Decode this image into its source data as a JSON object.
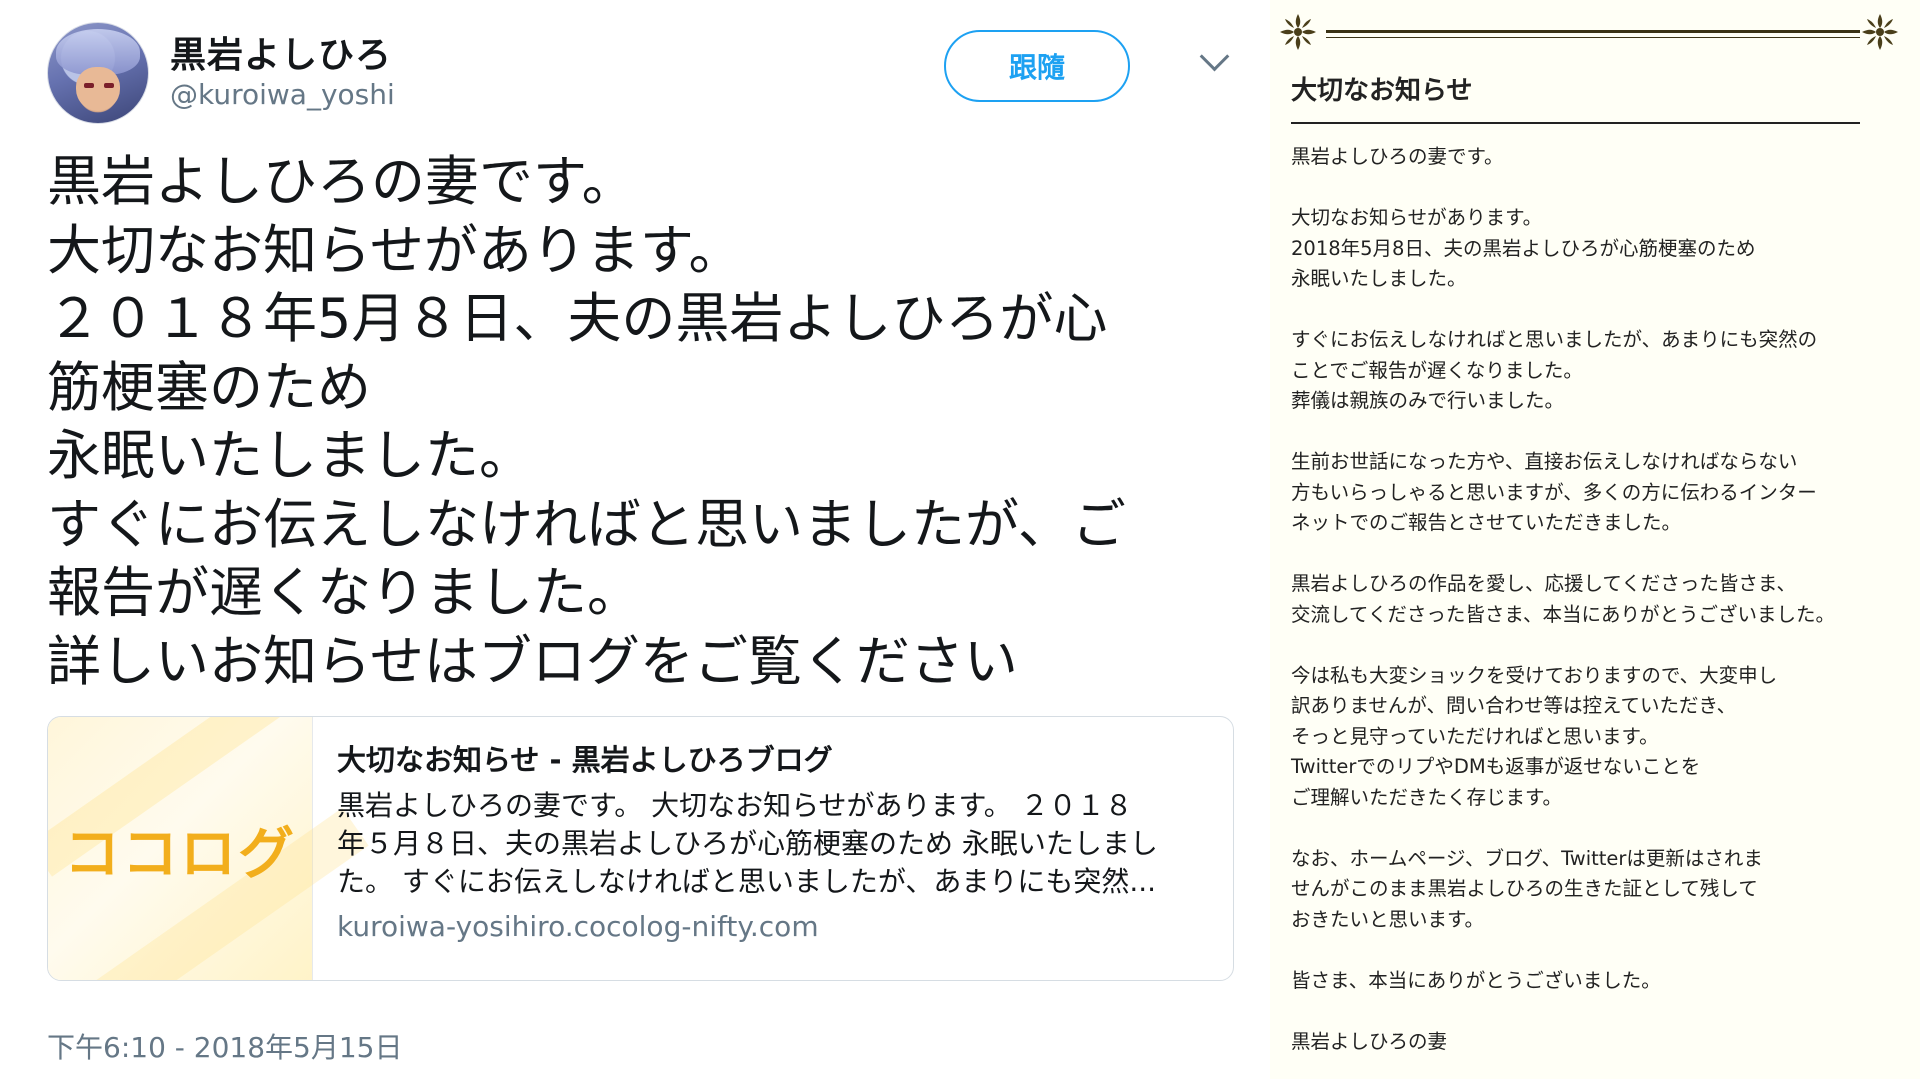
{
  "tweet": {
    "display_name": "黒岩よしひろ",
    "handle": "@kuroiwa_yoshi",
    "follow_label": "跟隨",
    "text_lines": [
      "黒岩よしひろの妻です。",
      "大切なお知らせがあります。",
      "２０１８年5月８日、夫の黒岩よしひろが心",
      "筋梗塞のため",
      "永眠いたしました。",
      "すぐにお伝えしなければと思いましたが、ご",
      "報告が遅くなりました。",
      "詳しいお知らせはブログをご覧ください"
    ],
    "card": {
      "logo_text": "ココログ",
      "title": "大切なお知らせ - 黒岩よしひろブログ",
      "desc_lines": [
        "黒岩よしひろの妻です。 大切なお知らせがあります。 ２０１８",
        "年５月８日、夫の黒岩よしひろが心筋梗塞のため 永眠いたしまし",
        "た。 すぐにお伝えしなければと思いましたが、あまりにも突然..."
      ],
      "url": "kuroiwa-yosihiro.cocolog-nifty.com"
    },
    "timestamp": "下午6:10 - 2018年5月15日"
  },
  "blog": {
    "title": "大切なお知らせ",
    "body_lines": [
      "黒岩よしひろの妻です。",
      "",
      "大切なお知らせがあります。",
      "2018年5月8日、夫の黒岩よしひろが心筋梗塞のため",
      "永眠いたしました。",
      "",
      "すぐにお伝えしなければと思いましたが、あまりにも突然の",
      "ことでご報告が遅くなりました。",
      "葬儀は親族のみで行いました。",
      "",
      "生前お世話になった方や、直接お伝えしなければならない",
      "方もいらっしゃると思いますが、多くの方に伝わるインター",
      "ネットでのご報告とさせていただきました。",
      "",
      "黒岩よしひろの作品を愛し、応援してくださった皆さま、",
      "交流してくださった皆さま、本当にありがとうございました。",
      "",
      "今は私も大変ショックを受けておりますので、大変申し",
      "訳ありませんが、問い合わせ等は控えていただき、",
      "そっと見守っていただければと思います。",
      "TwitterでのリプやDMも返事が返せないことを",
      "ご理解いただきたく存じます。",
      "",
      "なお、ホームページ、ブログ、Twitterは更新はされま",
      "せんがこのまま黒岩よしひろの生きた証として残して",
      "おきたいと思います。",
      "",
      "皆さま、本当にありがとうございました。",
      "",
      "黒岩よしひろの妻"
    ]
  },
  "icons": {
    "caret": "chevron-down-icon",
    "ornament": "fleur-ornament-icon"
  },
  "colors": {
    "twitter_blue": "#1da1f2",
    "secondary_text": "#657786",
    "cocolog_orange": "#f2ae1c",
    "blog_bg": "#fffff6"
  }
}
